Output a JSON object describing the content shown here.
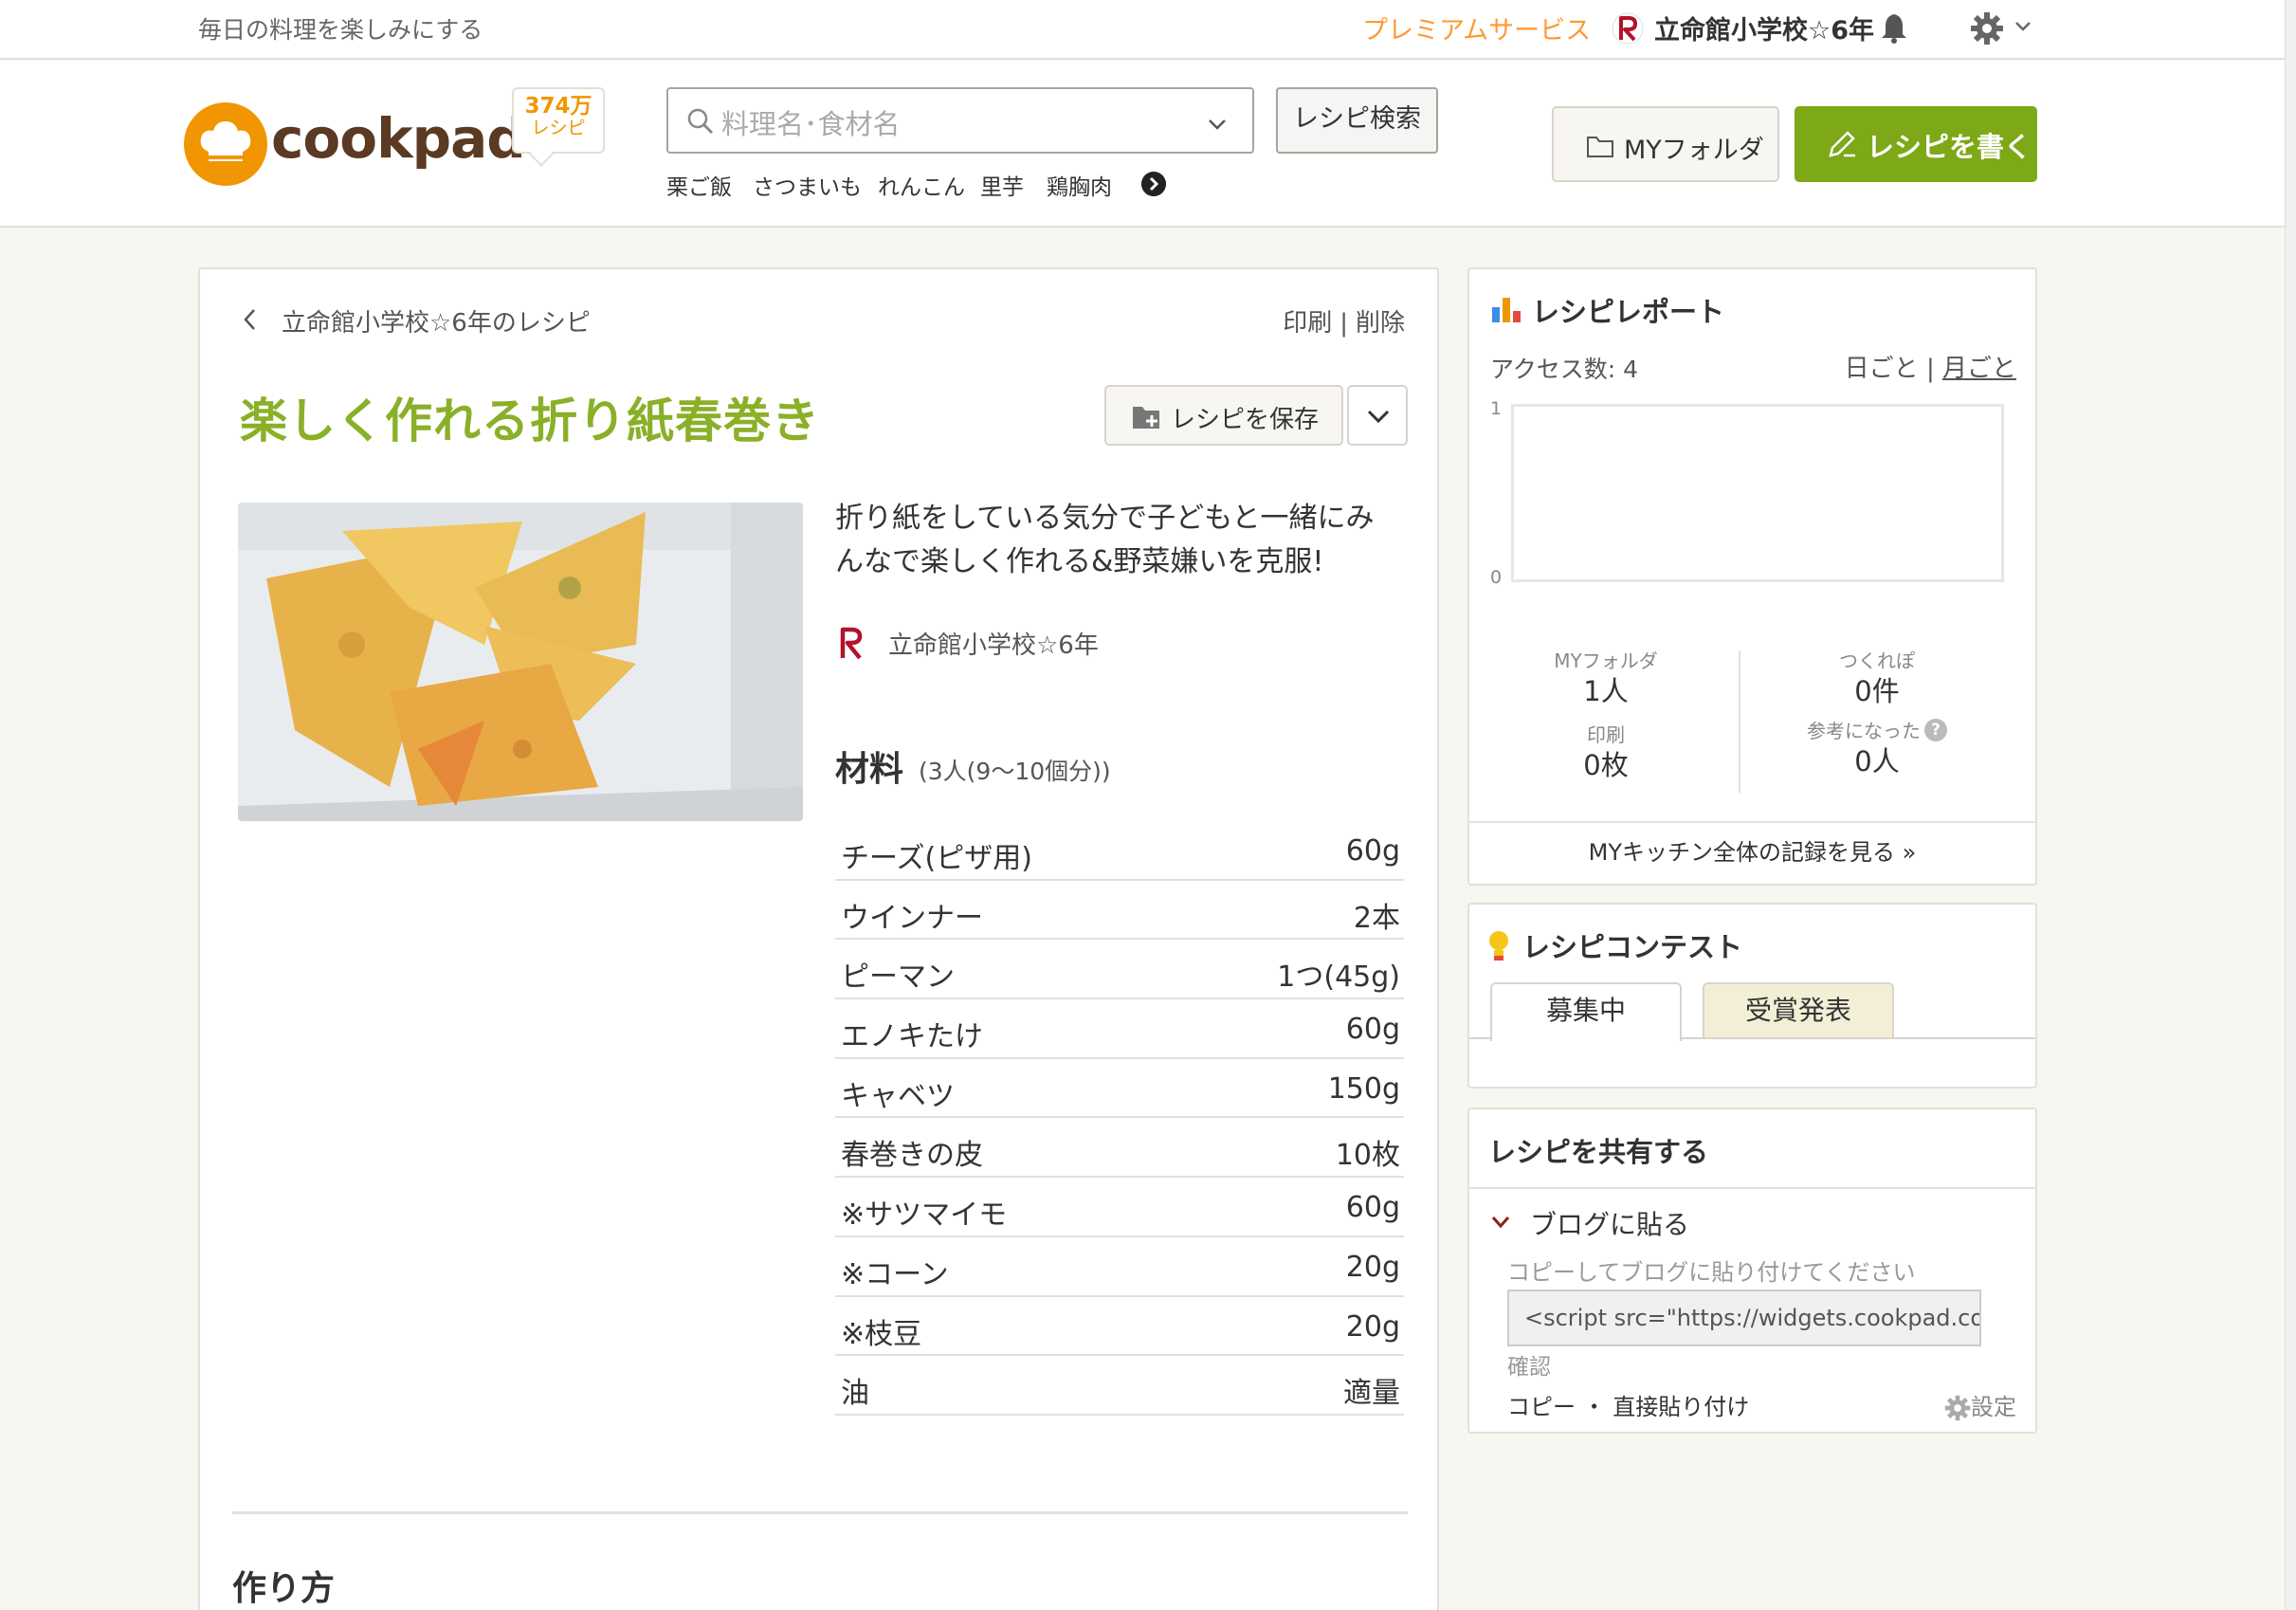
{
  "topbar": {
    "tagline": "毎日の料理を楽しみにする",
    "premium": "プレミアムサービス",
    "user": "立命館小学校☆6年"
  },
  "header": {
    "logo_text": "cookpad",
    "recipe_count": "374万",
    "recipe_unit": "レシピ",
    "search_placeholder": "料理名･食材名",
    "search_button": "レシピ検索",
    "keywords": [
      "栗ご飯",
      "さつまいも",
      "れんこん",
      "里芋",
      "鶏胸肉"
    ],
    "myfolder": "MYフォルダ",
    "write": "レシピを書く"
  },
  "recipe": {
    "back": "立命館小学校☆6年のレシピ",
    "print": "印刷",
    "sep": "|",
    "delete": "削除",
    "title": "楽しく作れる折り紙春巻き",
    "save": "レシピを保存",
    "description": "折り紙をしている気分で子どもと一緒にみんなで楽しく作れる&野菜嫌いを克服!",
    "author": "立命館小学校☆6年",
    "ingredients_heading": "材料",
    "servings": "(3人(9～10個分))",
    "ingredients": [
      {
        "name": "チーズ(ピザ用)",
        "qty": "60g"
      },
      {
        "name": "ウインナー",
        "qty": "2本"
      },
      {
        "name": "ピーマン",
        "qty": "1つ(45g)"
      },
      {
        "name": "エノキたけ",
        "qty": "60g"
      },
      {
        "name": "キャベツ",
        "qty": "150g"
      },
      {
        "name": "春巻きの皮",
        "qty": "10枚"
      },
      {
        "name": "※サツマイモ",
        "qty": "60g"
      },
      {
        "name": "※コーン",
        "qty": "20g"
      },
      {
        "name": "※枝豆",
        "qty": "20g"
      },
      {
        "name": "油",
        "qty": "適量"
      }
    ],
    "steps_heading": "作り方"
  },
  "report": {
    "title": "レシピレポート",
    "access": "アクセス数: 4",
    "daily": "日ごと",
    "monthly": "月ごと",
    "sep": "|",
    "y_max": "1",
    "y_min": "0",
    "stats": {
      "myfolder_label": "MYフォルダ",
      "myfolder_value": "1人",
      "tsukurepo_label": "つくれぽ",
      "tsukurepo_value": "0件",
      "print_label": "印刷",
      "print_value": "0枚",
      "helpful_label": "参考になった",
      "helpful_value": "0人"
    },
    "footer": "MYキッチン全体の記録を見る »"
  },
  "contest": {
    "title": "レシピコンテスト",
    "tab_active": "募集中",
    "tab_inactive": "受賞発表"
  },
  "share": {
    "title": "レシピを共有する",
    "blog": "ブログに貼る",
    "hint": "コピーしてブログに貼り付けてください",
    "code": "<script src=\"https://widgets.cookpad.com",
    "confirm": "確認",
    "copy": "コピー",
    "dot": "・",
    "direct": "直接貼り付け",
    "settings": "設定"
  },
  "colors": {
    "brand_green": "#7da818",
    "title_green": "#8ab028",
    "premium_orange": "#ff9933",
    "logo_orange": "#f19600"
  }
}
